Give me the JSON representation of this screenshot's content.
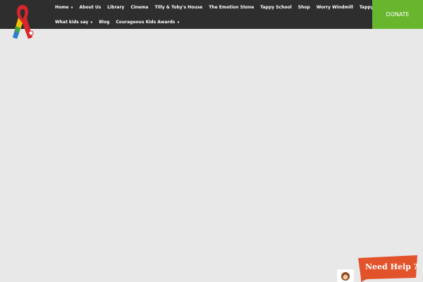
{
  "nav": {
    "row1": [
      {
        "label": "Home",
        "dropdown": true
      },
      {
        "label": "About Us",
        "dropdown": false
      },
      {
        "label": "Library",
        "dropdown": false
      },
      {
        "label": "Cinema",
        "dropdown": false
      },
      {
        "label": "Tilly & Toby's House",
        "dropdown": false
      },
      {
        "label": "The Emotion Stone",
        "dropdown": false
      },
      {
        "label": "Tappy School",
        "dropdown": false
      },
      {
        "label": "Shop",
        "dropdown": false
      },
      {
        "label": "Worry Windmill",
        "dropdown": false
      },
      {
        "label": "Tappy Bus",
        "dropdown": false
      }
    ],
    "row2": [
      {
        "label": "What kids say",
        "dropdown": true
      },
      {
        "label": "Blog",
        "dropdown": false
      },
      {
        "label": "Courageous Kids Awards",
        "dropdown": true
      }
    ]
  },
  "donate": {
    "label": "DONATE"
  },
  "help": {
    "label": "Need Help ?"
  },
  "colors": {
    "topbar": "#2e2e2e",
    "donate": "#67b62e",
    "help_bubble": "#e2532b",
    "page_background": "#e8e8e8"
  },
  "icons": {
    "logo": "awareness-ribbon-logo",
    "dropdown": "chevron-down-icon",
    "help_avatar": "girl-avatar-icon"
  }
}
